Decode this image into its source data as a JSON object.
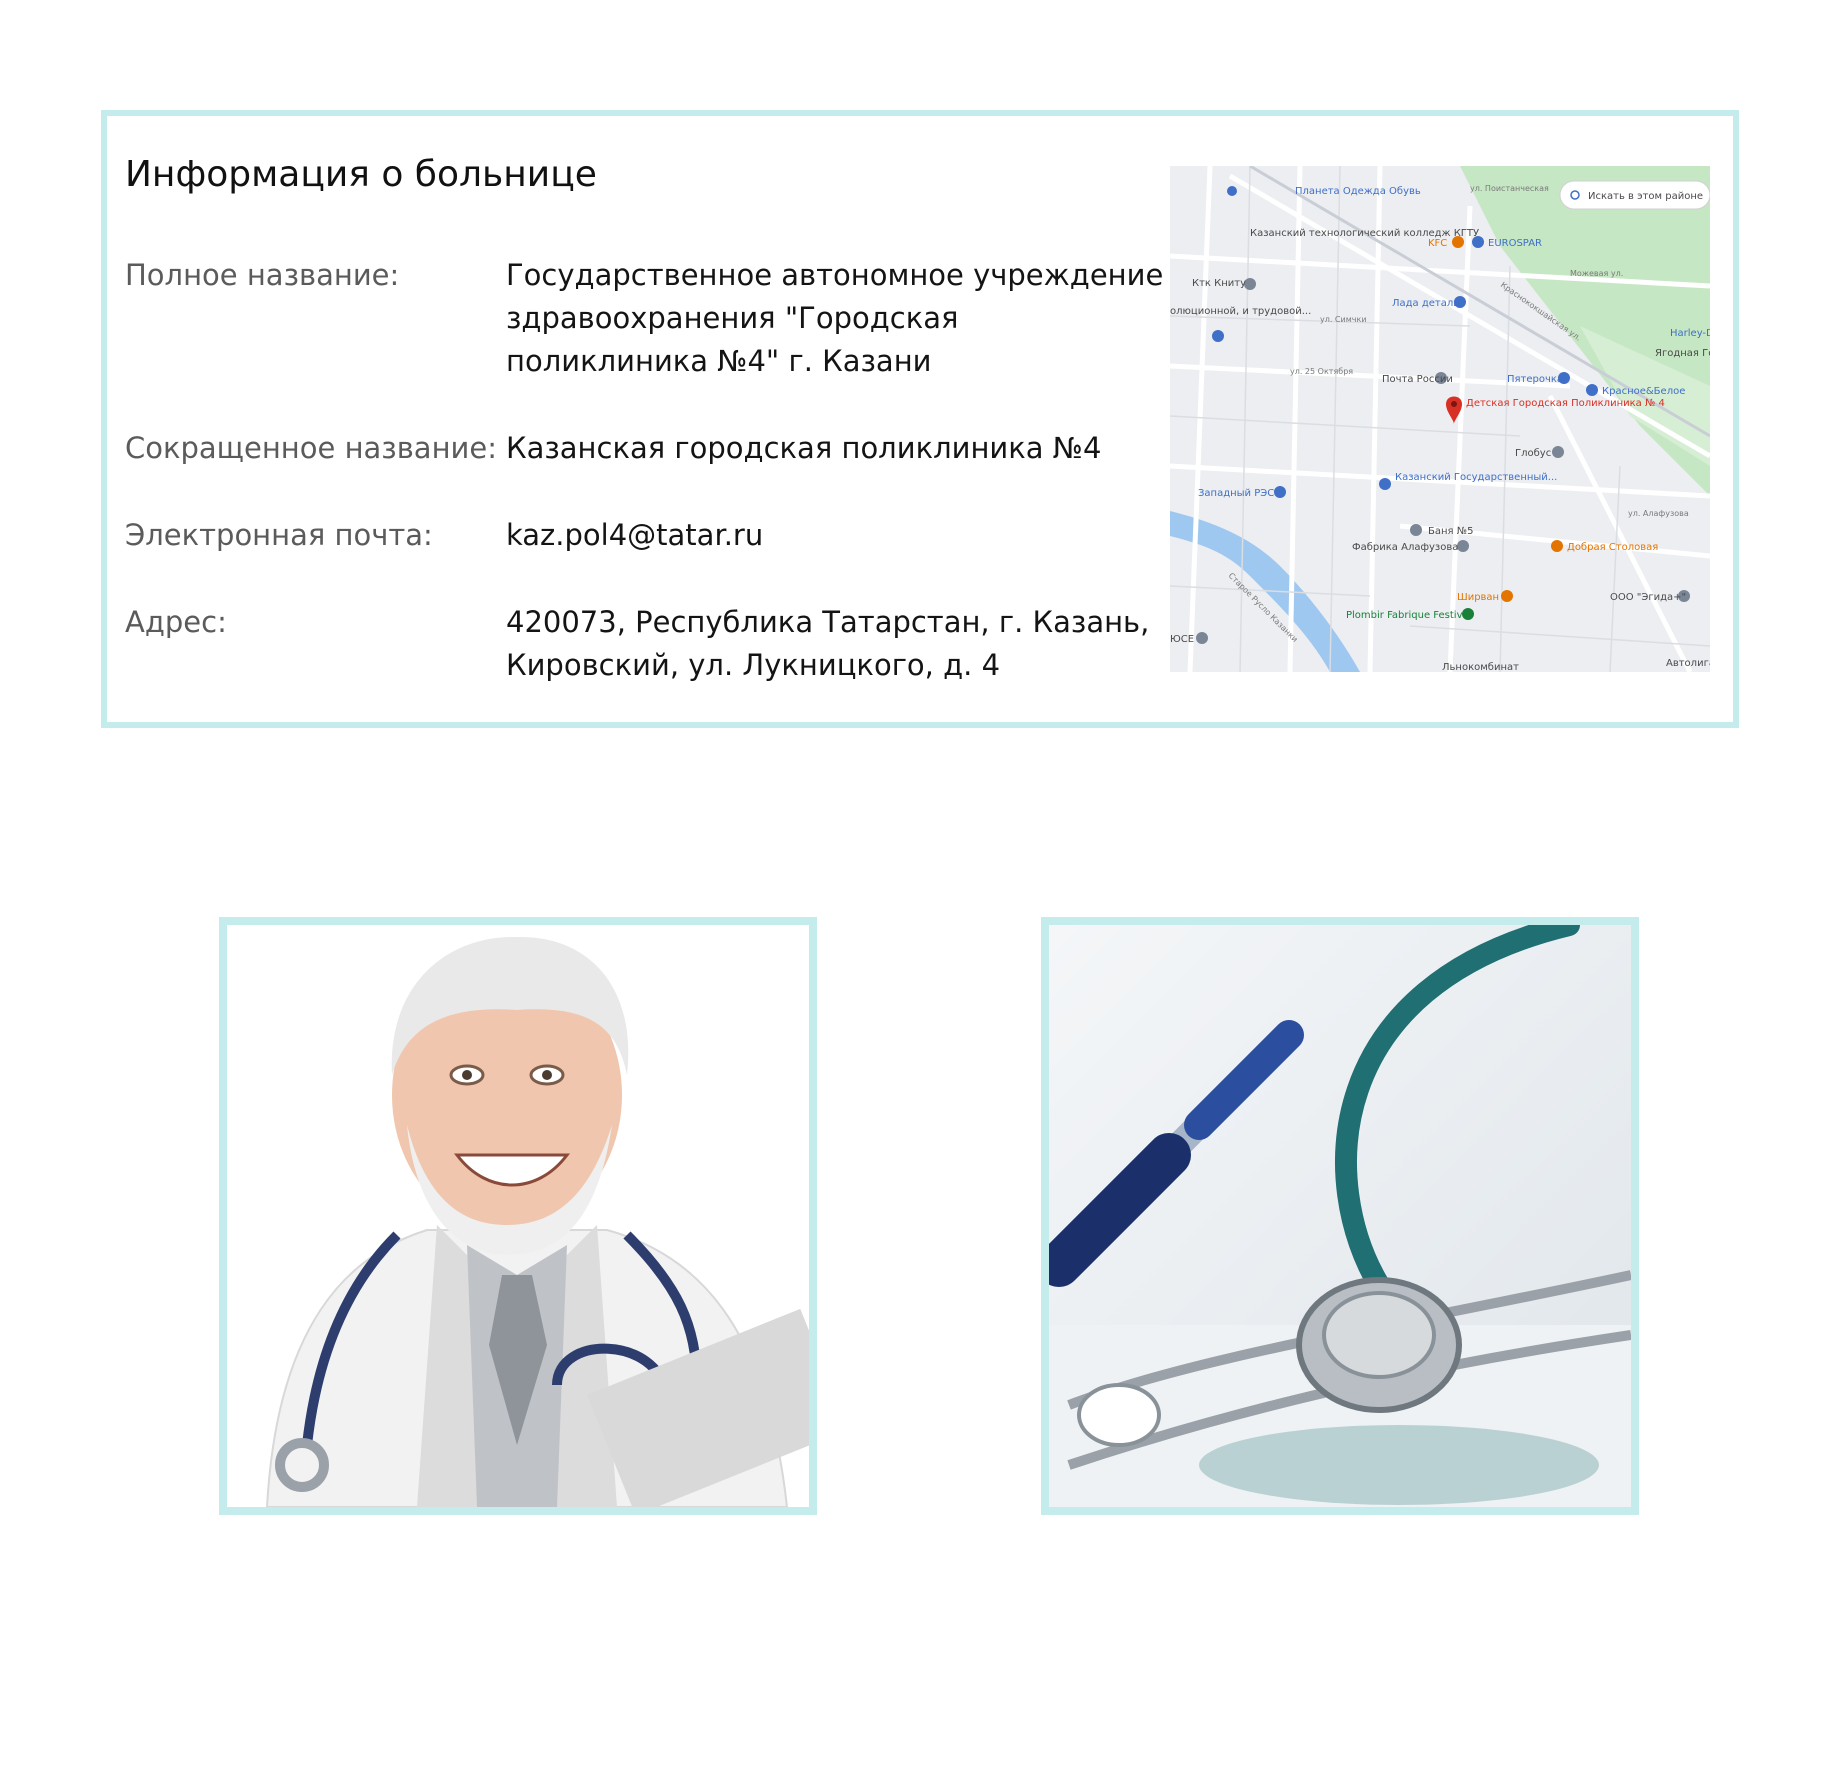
{
  "info": {
    "title": "Информация о больнице",
    "rows": [
      {
        "label": "Полное название:",
        "value": " Государственное автономное учреждение здравоохранения \"Городская поликлиника №4\" г. Казани"
      },
      {
        "label": "Сокращенное название:",
        "value": "Казанская городская поликлиника №4"
      },
      {
        "label": "Электронная почта:",
        "value": "kaz.pol4@tatar.ru"
      },
      {
        "label": "Адрес:",
        "value": "420073, Республика Татарстан, г. Казань, Кировский, ул. Лукницкого, д. 4"
      }
    ]
  },
  "map": {
    "search_button": "Искать в этом районе",
    "places": [
      {
        "name": "Планета Одежда Обувь",
        "icon": "shopping-bag-icon"
      },
      {
        "name": "ул. Поистанческая",
        "icon": "street"
      },
      {
        "name": "Казанский технологический колледж КГТУ",
        "icon": "school-icon"
      },
      {
        "name": "KFC",
        "icon": "restaurant-icon"
      },
      {
        "name": "EUROSPAR",
        "icon": "shopping-cart-icon"
      },
      {
        "name": "Ктк Книту",
        "icon": "place-icon"
      },
      {
        "name": "Лада деталь",
        "icon": "shopping-icon"
      },
      {
        "name": "Пятерочка",
        "icon": "shopping-cart-icon"
      },
      {
        "name": "Почта России",
        "icon": "mail-icon"
      },
      {
        "name": "Детская Городская Поликлиника № 4",
        "icon": "red-pin-icon"
      },
      {
        "name": "Красное&Белое",
        "icon": "shopping-cart-icon"
      },
      {
        "name": "Harley-Davids",
        "icon": "place-icon"
      },
      {
        "name": "Ягодная Гора Ж",
        "icon": "place-icon"
      },
      {
        "name": "Глобус",
        "icon": "place-icon"
      },
      {
        "name": "Казанский Государственный...",
        "icon": "school-icon"
      },
      {
        "name": "Западный РЭС",
        "icon": "place-icon"
      },
      {
        "name": "Баня №5",
        "icon": "place-icon"
      },
      {
        "name": "Фабрика Алафузова",
        "icon": "place-icon"
      },
      {
        "name": "Добрая Столовая",
        "icon": "restaurant-icon"
      },
      {
        "name": "Ширван",
        "icon": "restaurant-icon"
      },
      {
        "name": "ООО \"Эгида+\"",
        "icon": "place-icon"
      },
      {
        "name": "Plombir Fabrique Festival",
        "icon": "place-icon"
      },
      {
        "name": "олюционной, и трудовой...",
        "icon": "place-icon"
      },
      {
        "name": "ЮСЕ",
        "icon": "place-icon"
      },
      {
        "name": "Льнокомбинат",
        "icon": "place-icon"
      },
      {
        "name": "Автолига",
        "icon": "place-icon"
      },
      {
        "name": "Старое Русло Казанки",
        "icon": "water"
      },
      {
        "name": "Краснококшайская ул.",
        "icon": "street"
      },
      {
        "name": "ул. 25 Октября",
        "icon": "street"
      },
      {
        "name": "ул. Симчки",
        "icon": "street"
      },
      {
        "name": "ул. Алафузова",
        "icon": "street"
      },
      {
        "name": "Можевая ул.",
        "icon": "street"
      }
    ]
  },
  "colors": {
    "frame_border": "#c4ecec",
    "map_pin_red": "#d93025",
    "map_water": "#9fc8f0",
    "map_park": "#c6e7c3"
  },
  "photos": {
    "left": {
      "subject": "doctor-portrait",
      "accent": "#2d3e6e"
    },
    "right": {
      "subject": "stethoscope-and-pen",
      "accent": "#1f6f73"
    }
  }
}
